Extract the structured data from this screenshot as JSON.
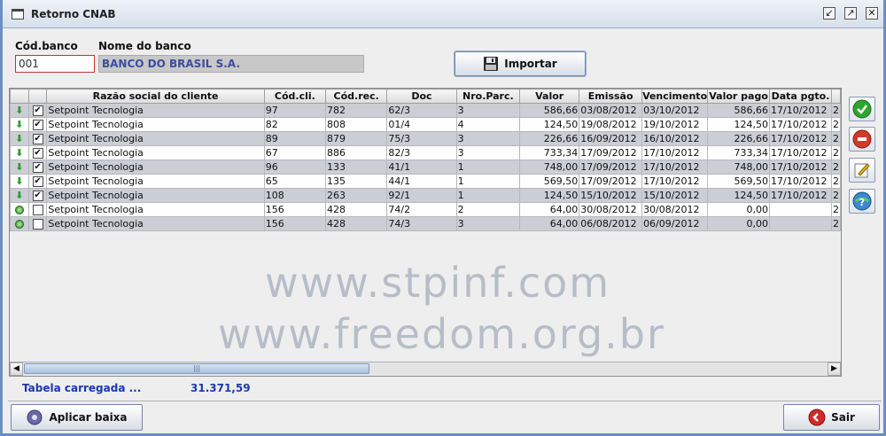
{
  "window": {
    "title": "Retorno CNAB"
  },
  "form": {
    "code_label": "Cód.banco",
    "code_value": "001",
    "name_label": "Nome do banco",
    "name_value": "BANCO DO BRASIL S.A.",
    "import_label": "Importar"
  },
  "watermark": {
    "brand": "Setpoint",
    "brand_sub": "Tecnologia",
    "url1": "www.stpinf.com",
    "url2": "www.freedom.org.br"
  },
  "table": {
    "columns": [
      "",
      "",
      "Razão social do cliente",
      "Cód.cli.",
      "Cód.rec.",
      "Doc",
      "Nro.Parc.",
      "Valor",
      "Emissão",
      "Vencimento",
      "Valor pago",
      "Data pgto.",
      ""
    ],
    "rows": [
      {
        "status": "arrow",
        "checked": true,
        "cells": [
          "Setpoint Tecnologia",
          "97",
          "782",
          "62/3",
          "3",
          "586,66",
          "03/08/2012",
          "03/10/2012",
          "586,66",
          "17/10/2012",
          "2"
        ]
      },
      {
        "status": "arrow",
        "checked": true,
        "cells": [
          "Setpoint Tecnologia",
          "82",
          "808",
          "01/4",
          "4",
          "124,50",
          "19/08/2012",
          "19/10/2012",
          "124,50",
          "17/10/2012",
          "2"
        ]
      },
      {
        "status": "arrow",
        "checked": true,
        "cells": [
          "Setpoint Tecnologia",
          "89",
          "879",
          "75/3",
          "3",
          "226,66",
          "16/09/2012",
          "16/10/2012",
          "226,66",
          "17/10/2012",
          "2"
        ]
      },
      {
        "status": "arrow",
        "checked": true,
        "cells": [
          "Setpoint Tecnologia",
          "67",
          "886",
          "82/3",
          "3",
          "733,34",
          "17/09/2012",
          "17/10/2012",
          "733,34",
          "17/10/2012",
          "2"
        ]
      },
      {
        "status": "arrow",
        "checked": true,
        "cells": [
          "Setpoint Tecnologia",
          "96",
          "133",
          "41/1",
          "1",
          "748,00",
          "17/09/2012",
          "17/10/2012",
          "748,00",
          "17/10/2012",
          "2"
        ]
      },
      {
        "status": "arrow",
        "checked": true,
        "cells": [
          "Setpoint Tecnologia",
          "65",
          "135",
          "44/1",
          "1",
          "569,50",
          "17/09/2012",
          "17/10/2012",
          "569,50",
          "17/10/2012",
          "2"
        ]
      },
      {
        "status": "arrow",
        "checked": true,
        "cells": [
          "Setpoint Tecnologia",
          "108",
          "263",
          "92/1",
          "1",
          "124,50",
          "15/10/2012",
          "15/10/2012",
          "124,50",
          "17/10/2012",
          "2"
        ]
      },
      {
        "status": "dot",
        "checked": false,
        "cells": [
          "Setpoint Tecnologia",
          "156",
          "428",
          "74/2",
          "2",
          "64,00",
          "30/08/2012",
          "30/08/2012",
          "0,00",
          "",
          "2"
        ]
      },
      {
        "status": "dot",
        "checked": false,
        "cells": [
          "Setpoint Tecnologia",
          "156",
          "428",
          "74/3",
          "3",
          "64,00",
          "06/08/2012",
          "06/09/2012",
          "0,00",
          "",
          "2"
        ]
      }
    ]
  },
  "status_bar": {
    "label": "Tabela carregada ...",
    "total": "31.371,59"
  },
  "bottom": {
    "apply_label": "Aplicar baixa",
    "exit_label": "Sair"
  },
  "side_icons": [
    "confirm-icon",
    "cancel-icon",
    "edit-icon",
    "help-icon"
  ],
  "colors": {
    "accent": "#1a3aa8",
    "row_alt": "#c4c8d0",
    "title_bg": "#dfe6f1"
  }
}
